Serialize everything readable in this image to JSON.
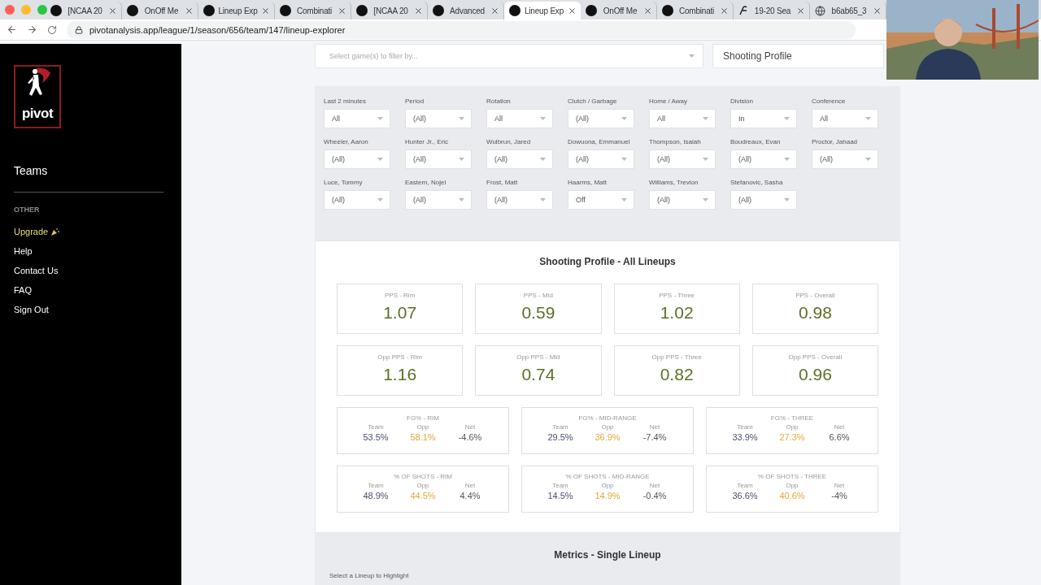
{
  "browser": {
    "tabs": [
      {
        "title": "[NCAA 20",
        "kind": "pivot",
        "selected": false
      },
      {
        "title": "OnOff Me",
        "kind": "pivot",
        "selected": false
      },
      {
        "title": "Lineup Exp",
        "kind": "pivot",
        "selected": false
      },
      {
        "title": "Combinati",
        "kind": "pivot",
        "selected": false
      },
      {
        "title": "[NCAA 20",
        "kind": "pivot",
        "selected": false
      },
      {
        "title": "Advanced",
        "kind": "pivot",
        "selected": false
      },
      {
        "title": "Lineup Exp",
        "kind": "pivot",
        "selected": true
      },
      {
        "title": "OnOff Me",
        "kind": "pivot",
        "selected": false
      },
      {
        "title": "Combinati",
        "kind": "pivot",
        "selected": false
      },
      {
        "title": "19-20 Sea",
        "kind": "script",
        "selected": false
      },
      {
        "title": "b6ab65_3",
        "kind": "globe",
        "selected": false
      }
    ],
    "address": "pivotanalysis.app/league/1/season/656/team/147/lineup-explorer"
  },
  "sidebar": {
    "logo_text": "pivot",
    "nav_items": [
      {
        "label": "Teams"
      }
    ],
    "section": "OTHER",
    "links": [
      {
        "label": "Upgrade",
        "kind": "upgrade"
      },
      {
        "label": "Help",
        "kind": "link"
      },
      {
        "label": "Contact Us",
        "kind": "link"
      },
      {
        "label": "FAQ",
        "kind": "link"
      },
      {
        "label": "Sign Out",
        "kind": "link"
      }
    ]
  },
  "game_filter": {
    "placeholder": "Select game(s) to filter by..."
  },
  "view_select": {
    "value": "Shooting Profile"
  },
  "filters": [
    [
      {
        "label": "Last 2 minutes",
        "value": "All"
      },
      {
        "label": "Period",
        "value": "(All)"
      },
      {
        "label": "Rotation",
        "value": "All"
      },
      {
        "label": "Clutch / Garbage",
        "value": "(All)"
      },
      {
        "label": "Home / Away",
        "value": "All"
      },
      {
        "label": "Division",
        "value": "In"
      },
      {
        "label": "Conference",
        "value": "All"
      }
    ],
    [
      {
        "label": "Wheeler, Aaron",
        "value": "(All)"
      },
      {
        "label": "Hunter Jr., Eric",
        "value": "(All)"
      },
      {
        "label": "Wulbrun, Jared",
        "value": "(All)"
      },
      {
        "label": "Dowuona, Emmanuel",
        "value": "(All)"
      },
      {
        "label": "Thompson, Isaiah",
        "value": "(All)"
      },
      {
        "label": "Boudreaux, Evan",
        "value": "(All)"
      },
      {
        "label": "Proctor, Jahaad",
        "value": "(All)"
      }
    ],
    [
      {
        "label": "Luce, Tommy",
        "value": "(All)"
      },
      {
        "label": "Eastern, Nojel",
        "value": "(All)"
      },
      {
        "label": "Frost, Matt",
        "value": "(All)"
      },
      {
        "label": "Haarms, Matt",
        "value": "Off"
      },
      {
        "label": "Williams, Trevion",
        "value": "(All)"
      },
      {
        "label": "Stefanovic, Sasha",
        "value": "(All)"
      }
    ]
  ],
  "shooting_profile": {
    "title": "Shooting Profile - All Lineups",
    "pps_cards": [
      {
        "label": "PPS - Rim",
        "value": "1.07"
      },
      {
        "label": "PPS - Mid",
        "value": "0.59"
      },
      {
        "label": "PPS - Three",
        "value": "1.02"
      },
      {
        "label": "PPS - Overall",
        "value": "0.98"
      },
      {
        "label": "Opp PPS - Rim",
        "value": "1.16"
      },
      {
        "label": "Opp PPS - Mid",
        "value": "0.74"
      },
      {
        "label": "Opp PPS - Three",
        "value": "0.82"
      },
      {
        "label": "Opp PPS - Overall",
        "value": "0.96"
      }
    ],
    "split_cards": [
      {
        "title": "FG% - RIM",
        "columns": [
          {
            "label": "Team",
            "value": "53.5%",
            "kind": "team"
          },
          {
            "label": "Opp",
            "value": "58.1%",
            "kind": "opp"
          },
          {
            "label": "Net",
            "value": "-4.6%",
            "kind": "net"
          }
        ]
      },
      {
        "title": "FG% - MID-RANGE",
        "columns": [
          {
            "label": "Team",
            "value": "29.5%",
            "kind": "team"
          },
          {
            "label": "Opp",
            "value": "36.9%",
            "kind": "opp"
          },
          {
            "label": "Net",
            "value": "-7.4%",
            "kind": "net"
          }
        ]
      },
      {
        "title": "FG% - THREE",
        "columns": [
          {
            "label": "Team",
            "value": "33.9%",
            "kind": "team"
          },
          {
            "label": "Opp",
            "value": "27.3%",
            "kind": "opp"
          },
          {
            "label": "Net",
            "value": "6.6%",
            "kind": "net"
          }
        ]
      },
      {
        "title": "% OF SHOTS - RIM",
        "columns": [
          {
            "label": "Team",
            "value": "48.9%",
            "kind": "team"
          },
          {
            "label": "Opp",
            "value": "44.5%",
            "kind": "opp"
          },
          {
            "label": "Net",
            "value": "4.4%",
            "kind": "net"
          }
        ]
      },
      {
        "title": "% OF SHOTS - MID-RANGE",
        "columns": [
          {
            "label": "Team",
            "value": "14.5%",
            "kind": "team"
          },
          {
            "label": "Opp",
            "value": "14.9%",
            "kind": "opp"
          },
          {
            "label": "Net",
            "value": "-0.4%",
            "kind": "net"
          }
        ]
      },
      {
        "title": "% OF SHOTS - THREE",
        "columns": [
          {
            "label": "Team",
            "value": "36.6%",
            "kind": "team"
          },
          {
            "label": "Opp",
            "value": "40.6%",
            "kind": "opp"
          },
          {
            "label": "Net",
            "value": "-4%",
            "kind": "net"
          }
        ]
      }
    ]
  },
  "metrics": {
    "title": "Metrics - Single Lineup",
    "hint": "Select a Lineup to Highlight"
  }
}
